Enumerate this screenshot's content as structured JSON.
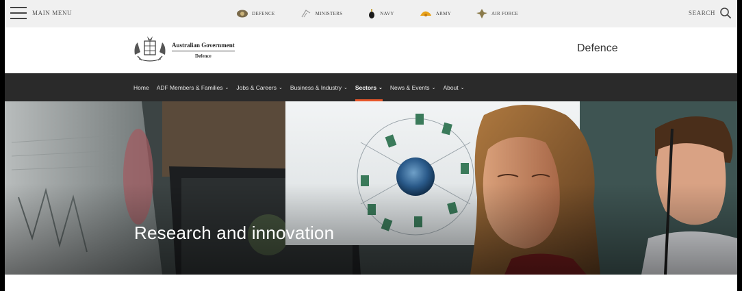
{
  "topbar": {
    "menu_label": "MAIN MENU",
    "search_label": "SEARCH",
    "services": [
      {
        "label": "DEFENCE",
        "icon": "defence-crest-icon"
      },
      {
        "label": "MINISTERS",
        "icon": "ministers-icon"
      },
      {
        "label": "NAVY",
        "icon": "navy-icon"
      },
      {
        "label": "ARMY",
        "icon": "army-icon"
      },
      {
        "label": "AIR FORCE",
        "icon": "air-force-icon"
      }
    ]
  },
  "header": {
    "logo_line1": "Australian Government",
    "logo_line2": "Defence",
    "site_title": "Defence"
  },
  "nav": {
    "items": [
      {
        "label": "Home",
        "dropdown": false
      },
      {
        "label": "ADF Members & Families",
        "dropdown": true
      },
      {
        "label": "Jobs & Careers",
        "dropdown": true
      },
      {
        "label": "Business & Industry",
        "dropdown": true
      },
      {
        "label": "Sectors",
        "dropdown": true,
        "active": true
      },
      {
        "label": "News & Events",
        "dropdown": true
      },
      {
        "label": "About",
        "dropdown": true
      }
    ],
    "active_color": "#e8572a"
  },
  "hero": {
    "title": "Research and innovation"
  }
}
